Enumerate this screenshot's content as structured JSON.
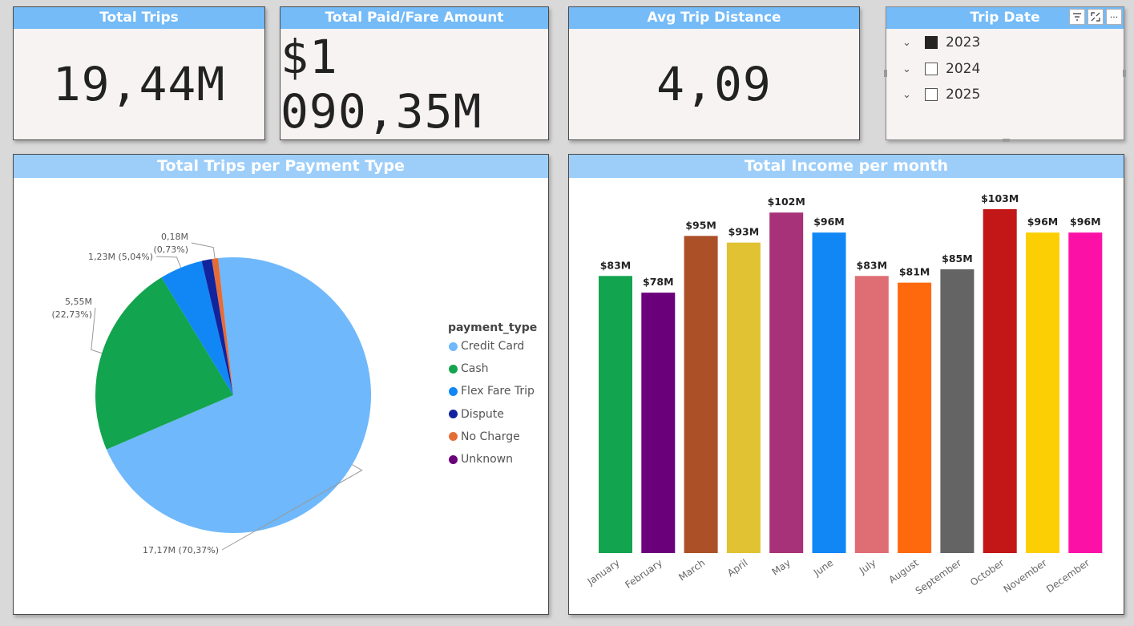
{
  "kpis": [
    {
      "title": "Total Trips",
      "value": "19,44M"
    },
    {
      "title": "Total Paid/Fare Amount",
      "value": "$1 090,35M"
    },
    {
      "title": "Avg Trip Distance",
      "value": "4,09"
    }
  ],
  "slicer": {
    "title": "Trip Date",
    "items": [
      {
        "label": "2023",
        "checked": true
      },
      {
        "label": "2024",
        "checked": false
      },
      {
        "label": "2025",
        "checked": false
      }
    ],
    "icons": [
      "filter-icon",
      "focus-mode-icon",
      "more-options-icon"
    ]
  },
  "pie_panel": {
    "title": "Total Trips per Payment Type",
    "legend_title": "payment_type"
  },
  "bar_panel": {
    "title": "Total Income per month"
  },
  "chart_data": [
    {
      "type": "pie",
      "title": "Total Trips per Payment Type",
      "legend_title": "payment_type",
      "legend_position": "right",
      "slices": [
        {
          "label": "Credit Card",
          "value": 17.17,
          "percent": 70.37,
          "data_label": "17,17M (70,37%)",
          "color": "#6fb8fb"
        },
        {
          "label": "Cash",
          "value": 5.55,
          "percent": 22.73,
          "data_label": "5,55M (22,73%)",
          "color": "#12a44e"
        },
        {
          "label": "Flex Fare Trip",
          "value": 1.23,
          "percent": 5.04,
          "data_label": "1,23M (5,04%)",
          "color": "#1187f5"
        },
        {
          "label": "Dispute",
          "value": 0.29,
          "percent": 1.13,
          "data_label": "",
          "color": "#12239e"
        },
        {
          "label": "No Charge",
          "value": 0.18,
          "percent": 0.73,
          "data_label": "0,18M (0,73%)",
          "color": "#e66c37"
        },
        {
          "label": "Unknown",
          "value": 0.0,
          "percent": 0.0,
          "data_label": "",
          "color": "#6b007b"
        }
      ]
    },
    {
      "type": "bar",
      "title": "Total Income per month",
      "categories": [
        "January",
        "February",
        "March",
        "April",
        "May",
        "June",
        "July",
        "August",
        "September",
        "October",
        "November",
        "December"
      ],
      "values": [
        83,
        78,
        95,
        93,
        102,
        96,
        83,
        81,
        85,
        103,
        96,
        96
      ],
      "value_labels": [
        "$83M",
        "$78M",
        "$95M",
        "$93M",
        "$102M",
        "$96M",
        "$83M",
        "$81M",
        "$85M",
        "$103M",
        "$96M",
        "$96M"
      ],
      "colors": [
        "#12a44e",
        "#6b007b",
        "#ac5028",
        "#e0c233",
        "#a83279",
        "#1187f5",
        "#df6d74",
        "#fe690d",
        "#646464",
        "#c31617",
        "#fccf04",
        "#fc11a6"
      ],
      "ylim": [
        0,
        103
      ],
      "grid": false
    }
  ]
}
